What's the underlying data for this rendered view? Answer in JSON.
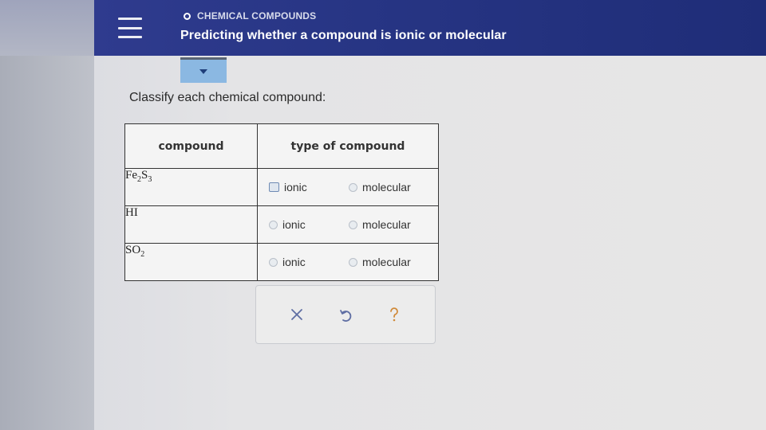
{
  "header": {
    "topic": "CHEMICAL COMPOUNDS",
    "title": "Predicting whether a compound is ionic or molecular"
  },
  "question": {
    "instruction": "Classify each chemical compound:"
  },
  "table": {
    "headers": {
      "compound": "compound",
      "type": "type of compound"
    },
    "rows": [
      {
        "formula": {
          "el1": "Fe",
          "sub1": "2",
          "el2": "S",
          "sub2": "3"
        },
        "opt_ionic": "ionic",
        "opt_molecular": "molecular"
      },
      {
        "formula": {
          "el1": "HI",
          "sub1": "",
          "el2": "",
          "sub2": ""
        },
        "opt_ionic": "ionic",
        "opt_molecular": "molecular"
      },
      {
        "formula": {
          "el1": "SO",
          "sub1": "2",
          "el2": "",
          "sub2": ""
        },
        "opt_ionic": "ionic",
        "opt_molecular": "molecular"
      }
    ]
  },
  "actions": {
    "icons": [
      "close-icon",
      "undo-icon",
      "help-icon"
    ]
  },
  "colors": {
    "header_bg": "#273584",
    "dropdown_tab": "#8bb8e2",
    "action_icon": "#5f6ea3",
    "help_icon": "#d08a3a"
  }
}
